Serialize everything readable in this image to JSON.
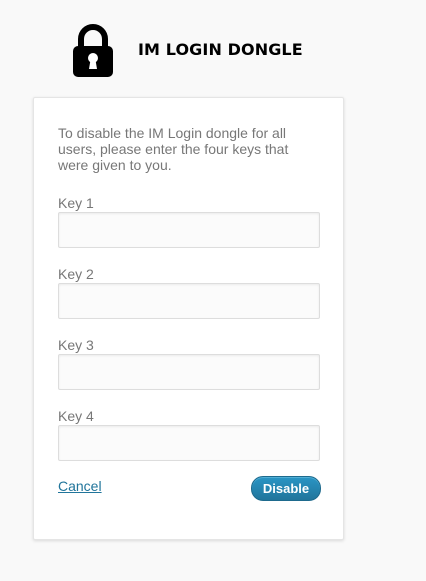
{
  "header": {
    "icon": "lock-icon",
    "title": "IM LOGIN DONGLE"
  },
  "form": {
    "intro": "To disable the IM Login dongle for all users, please enter the four keys that were given to you.",
    "fields": [
      {
        "label": "Key 1",
        "value": "",
        "placeholder": ""
      },
      {
        "label": "Key 2",
        "value": "",
        "placeholder": ""
      },
      {
        "label": "Key 3",
        "value": "",
        "placeholder": ""
      },
      {
        "label": "Key 4",
        "value": "",
        "placeholder": ""
      }
    ],
    "cancel_label": "Cancel",
    "submit_label": "Disable"
  },
  "colors": {
    "page_background": "#f9f9f9",
    "link": "#21759b",
    "primary_button": "#2e8cc2",
    "muted_text": "#777777"
  }
}
